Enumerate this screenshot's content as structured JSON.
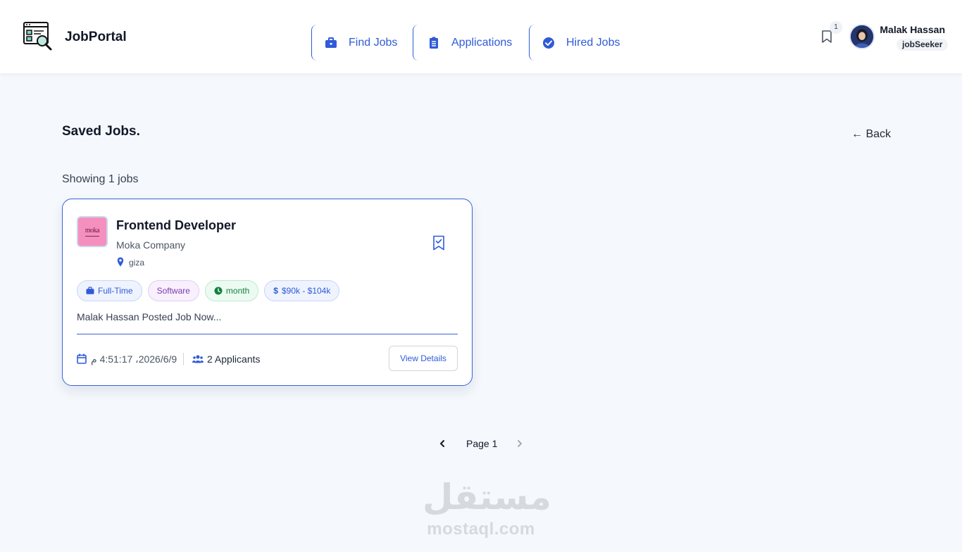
{
  "header": {
    "brand": "JobPortal",
    "nav": [
      {
        "label": "Find Jobs",
        "icon": "briefcase-icon"
      },
      {
        "label": "Applications",
        "icon": "clipboard-icon"
      },
      {
        "label": "Hired Jobs",
        "icon": "check-circle-icon"
      }
    ],
    "saved_count": "1",
    "user": {
      "name": "Malak Hassan",
      "role": "jobSeeker"
    }
  },
  "page": {
    "title": "Saved Jobs.",
    "back_label": "← Back",
    "showing_text": "Showing 1 jobs"
  },
  "job_card": {
    "title": "Frontend Developer",
    "company": "Moka Company",
    "company_logo_text": "moka",
    "location": "giza",
    "tags": {
      "type": "Full-Time",
      "category": "Software",
      "period": "month",
      "salary": "$90k - $104k"
    },
    "description": "Malak Hassan Posted Job Now...",
    "date": "2026/6/9، 4:51:17 م",
    "applicants": "2 Applicants",
    "view_label": "View Details"
  },
  "pagination": {
    "label": "Page 1"
  },
  "watermark": {
    "arabic": "مستقل",
    "latin": "mostaql.com"
  },
  "colors": {
    "accent": "#2f5bd8",
    "background": "#f5f8fc",
    "card_border": "#3a63d6",
    "tag_green": "#15803d",
    "tag_purple": "#7c3aad"
  }
}
